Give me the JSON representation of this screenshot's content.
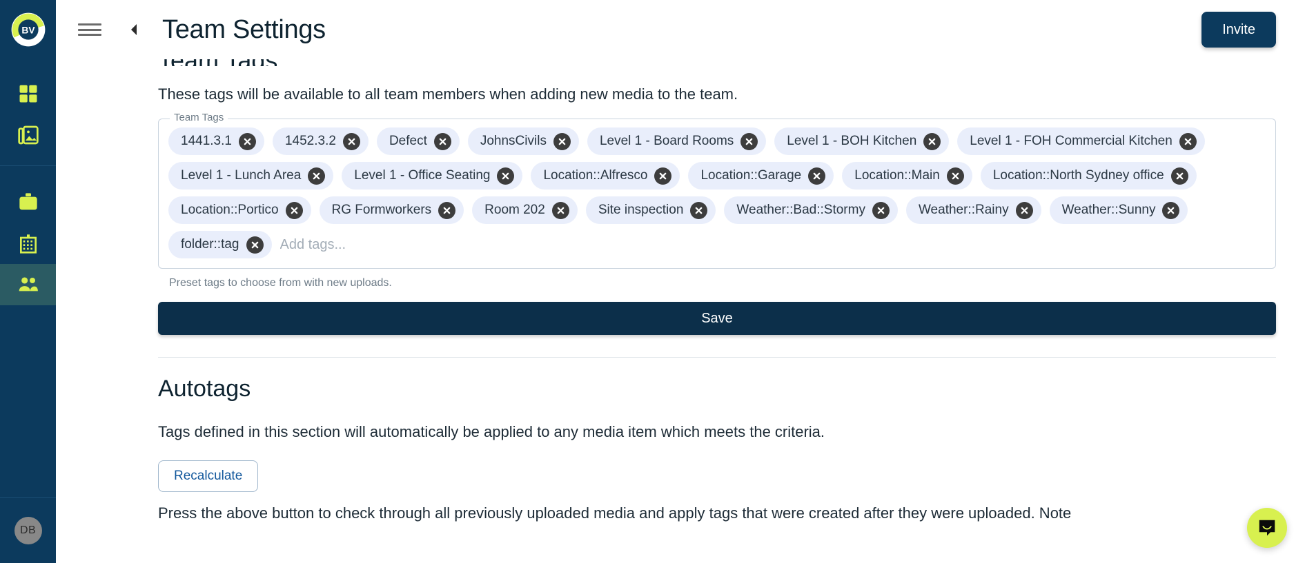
{
  "brand": {
    "logo_text": "BV",
    "accent_color": "#d8f04f",
    "sidebar_color": "#0c3a5d",
    "chip_color": "#e9eefb"
  },
  "sidebar": {
    "items": [
      {
        "icon": "dashboard-icon",
        "name": "sidebar-item-dashboard",
        "active": false
      },
      {
        "icon": "media-gallery-icon",
        "name": "sidebar-item-media",
        "active": false
      },
      {
        "icon": "briefcase-icon",
        "name": "sidebar-item-projects",
        "active": false
      },
      {
        "icon": "building-icon",
        "name": "sidebar-item-company",
        "active": false
      },
      {
        "icon": "people-icon",
        "name": "sidebar-item-team",
        "active": true
      }
    ],
    "avatar_initials": "DB"
  },
  "header": {
    "menu_icon": "hamburger-menu-icon",
    "back_icon": "chevron-left-icon",
    "title": "Team Settings",
    "invite_label": "Invite"
  },
  "team_tags_section": {
    "title": "Team Tags",
    "description": "These tags will be available to all team members when adding new media to the team.",
    "field_legend": "Team Tags",
    "tags": [
      "1441.3.1",
      "1452.3.2",
      "Defect",
      "JohnsCivils",
      "Level 1 - Board Rooms",
      "Level 1 - BOH Kitchen",
      "Level 1 - FOH Commercial Kitchen",
      "Level 1 - Lunch Area",
      "Level 1 - Office Seating",
      "Location::Alfresco",
      "Location::Garage",
      "Location::Main",
      "Location::North Sydney office",
      "Location::Portico",
      "RG Formworkers",
      "Room 202",
      "Site inspection",
      "Weather::Bad::Stormy",
      "Weather::Rainy",
      "Weather::Sunny",
      "folder::tag"
    ],
    "input_placeholder": "Add tags...",
    "input_value": "",
    "helper_text": "Preset tags to choose from with new uploads.",
    "save_label": "Save"
  },
  "autotags_section": {
    "title": "Autotags",
    "description": "Tags defined in this section will automatically be applied to any media item which meets the criteria.",
    "recalculate_label": "Recalculate",
    "footer_note": "Press the above button to check through all previously uploaded media and apply tags that were created after they were uploaded. Note"
  },
  "chat": {
    "icon": "chat-bubble-icon"
  }
}
